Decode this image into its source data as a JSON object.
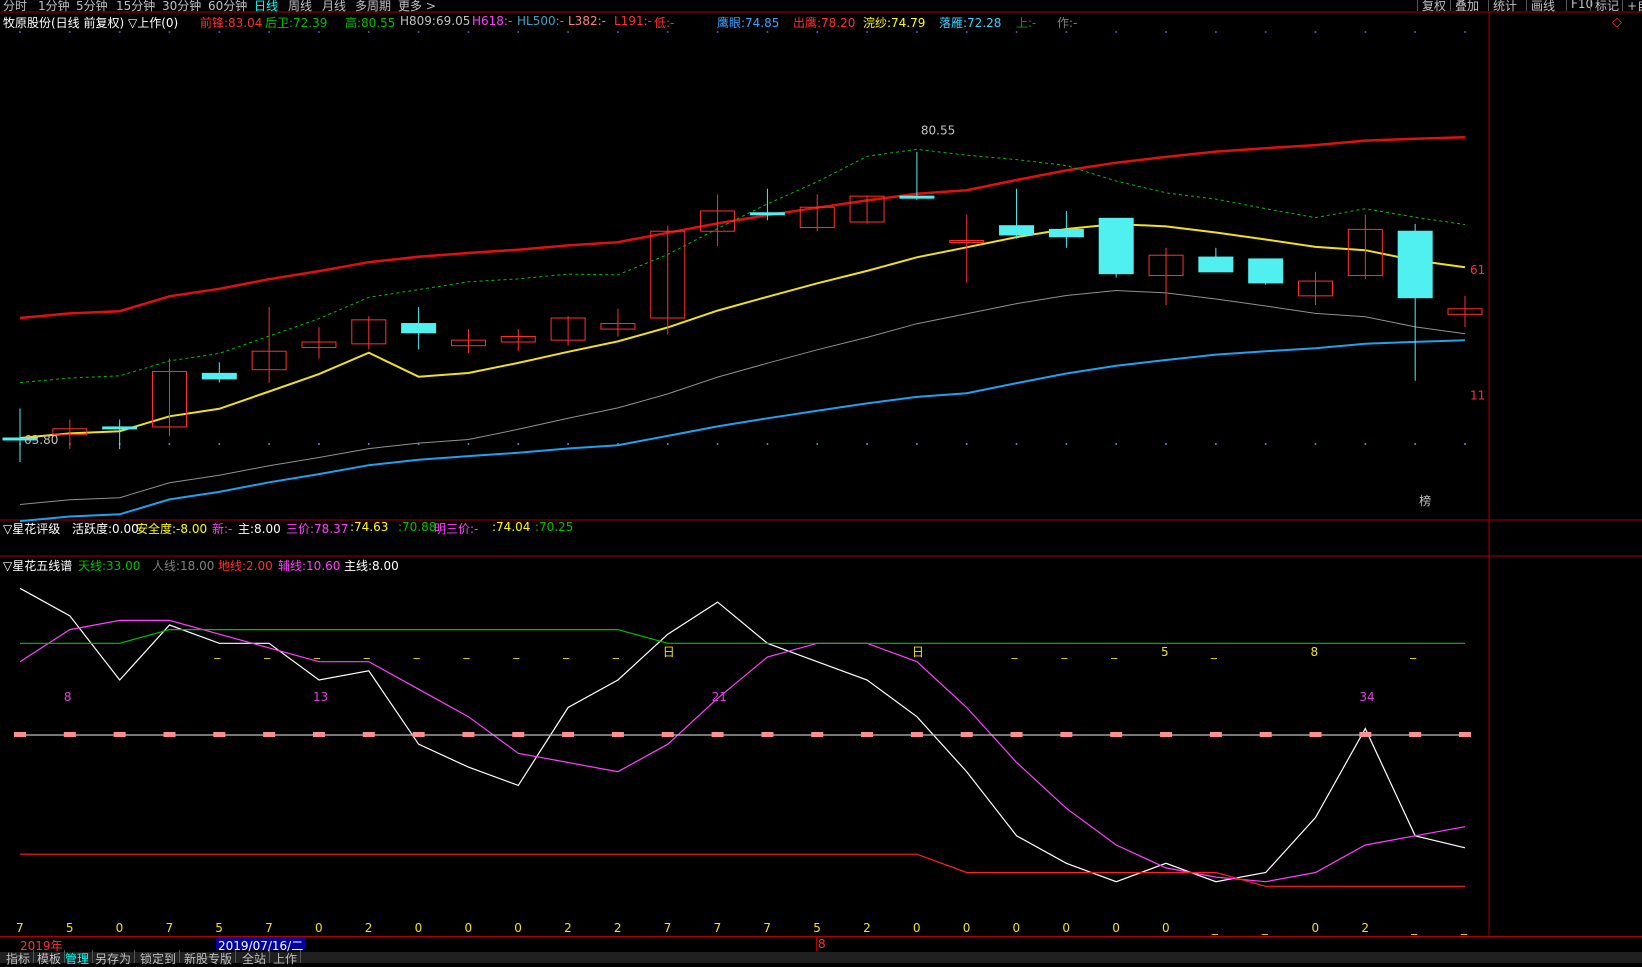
{
  "top_bar": {
    "periods": [
      "分时",
      "1分钟",
      "5分钟",
      "15分钟",
      "30分钟",
      "60分钟",
      "日线",
      "周线",
      "月线",
      "多周期",
      "更多 >"
    ],
    "active_period": "日线",
    "right_buttons": [
      "复权",
      "叠加",
      "统计",
      "画线",
      "F10",
      "标记",
      "+自"
    ]
  },
  "main_header": {
    "title": "牧原股份(日线 前复权) ▽上作(0)",
    "items": [
      {
        "label": "前锋:",
        "value": "83.04",
        "color": "#ff3030"
      },
      {
        "label": "后卫:",
        "value": "72.39",
        "color": "#00c000"
      },
      {
        "label": "高:",
        "value": "80.55",
        "color": "#00c000"
      },
      {
        "label": "H809:",
        "value": "69.05",
        "color": "#c0c0c0"
      },
      {
        "label": "H618:",
        "value": "-",
        "color": "#ff40ff"
      },
      {
        "label": "HL500:",
        "value": "-",
        "color": "#40a0c0"
      },
      {
        "label": "L382:",
        "value": "-",
        "color": "#ff8080"
      },
      {
        "label": "L191:",
        "value": "-",
        "color": "#ff3030"
      },
      {
        "label": "低:",
        "value": "-",
        "color": "#ff3030"
      },
      {
        "label": "鹰眼:",
        "value": "74.85",
        "color": "#40a0ff"
      },
      {
        "label": "出鹰:",
        "value": "78.20",
        "color": "#ff3030"
      },
      {
        "label": "浣纱:",
        "value": "74.79",
        "color": "#ffff00"
      },
      {
        "label": "落雁:",
        "value": "72.28",
        "color": "#40d0ff"
      },
      {
        "label": "上:",
        "value": "-",
        "color": "#00a000"
      },
      {
        "label": "作:",
        "value": "-",
        "color": "#808080"
      }
    ],
    "corner_icon": "diamond-icon"
  },
  "sub1_header": {
    "title": "▽星花评级",
    "items": [
      {
        "label": "活跃度:",
        "value": "0.00",
        "color": "#ffffff"
      },
      {
        "label": "安全度:",
        "value": "-8.00",
        "color": "#ffff00"
      },
      {
        "label": "新:",
        "value": "-",
        "color": "#ff40ff"
      },
      {
        "label": "主:",
        "value": "8.00",
        "color": "#ffffff"
      },
      {
        "label": "三价:",
        "value": "78.37",
        "color": "#ff40ff"
      },
      {
        "label": ":",
        "value": "74.63",
        "color": "#ffff00"
      },
      {
        "label": ":",
        "value": "70.88",
        "color": "#00c000"
      },
      {
        "label": "明三价:",
        "value": "-",
        "color": "#ff40ff"
      },
      {
        "label": ":",
        "value": "74.04",
        "color": "#ffff00"
      },
      {
        "label": ":",
        "value": "70.25",
        "color": "#00c000"
      }
    ]
  },
  "sub2_header": {
    "title": "▽星花五线谱",
    "items": [
      {
        "label": "天线:",
        "value": "33.00",
        "color": "#00c000"
      },
      {
        "label": "人线:",
        "value": "18.00",
        "color": "#808080"
      },
      {
        "label": "地线:",
        "value": "2.00",
        "color": "#ff3030"
      },
      {
        "label": "辅线:",
        "value": "10.60",
        "color": "#ff40ff"
      },
      {
        "label": "主线:",
        "value": "8.00",
        "color": "#ffffff"
      }
    ]
  },
  "chart_data": [
    {
      "type": "candlestick",
      "name": "main",
      "ylim": [
        60,
        86
      ],
      "candles": [
        {
          "o": 63.9,
          "h": 65.5,
          "l": 62.6,
          "c": 63.9,
          "color": "cyan"
        },
        {
          "o": 64.1,
          "h": 64.9,
          "l": 63.3,
          "c": 64.4,
          "color": "red"
        },
        {
          "o": 64.5,
          "h": 64.9,
          "l": 63.3,
          "c": 64.5,
          "color": "cyan"
        },
        {
          "o": 64.5,
          "h": 68.2,
          "l": 64.0,
          "c": 67.5,
          "color": "red"
        },
        {
          "o": 67.4,
          "h": 68.0,
          "l": 66.9,
          "c": 67.1,
          "color": "cyan"
        },
        {
          "o": 67.6,
          "h": 71.0,
          "l": 66.9,
          "c": 68.6,
          "color": "red"
        },
        {
          "o": 68.8,
          "h": 69.9,
          "l": 68.2,
          "c": 69.1,
          "color": "red"
        },
        {
          "o": 69.0,
          "h": 70.5,
          "l": 68.7,
          "c": 70.3,
          "color": "red"
        },
        {
          "o": 70.1,
          "h": 71.0,
          "l": 68.7,
          "c": 69.6,
          "color": "cyan"
        },
        {
          "o": 68.9,
          "h": 69.8,
          "l": 68.5,
          "c": 69.2,
          "color": "red"
        },
        {
          "o": 69.1,
          "h": 69.8,
          "l": 68.6,
          "c": 69.4,
          "color": "red"
        },
        {
          "o": 69.2,
          "h": 70.5,
          "l": 68.9,
          "c": 70.4,
          "color": "red"
        },
        {
          "o": 69.8,
          "h": 70.9,
          "l": 69.4,
          "c": 70.1,
          "color": "red"
        },
        {
          "o": 70.4,
          "h": 75.4,
          "l": 69.5,
          "c": 75.1,
          "color": "red"
        },
        {
          "o": 75.1,
          "h": 77.1,
          "l": 74.3,
          "c": 76.2,
          "color": "red"
        },
        {
          "o": 76.0,
          "h": 77.4,
          "l": 75.7,
          "c": 76.1,
          "color": "cyan"
        },
        {
          "o": 75.3,
          "h": 77.1,
          "l": 75.1,
          "c": 76.4,
          "color": "red"
        },
        {
          "o": 75.6,
          "h": 77.0,
          "l": 75.5,
          "c": 77.0,
          "color": "red"
        },
        {
          "o": 77.0,
          "h": 79.4,
          "l": 76.8,
          "c": 77.0,
          "color": "cyan"
        },
        {
          "o": 74.6,
          "h": 76.0,
          "l": 72.3,
          "c": 74.6,
          "color": "red"
        },
        {
          "o": 75.4,
          "h": 77.4,
          "l": 74.7,
          "c": 74.9,
          "color": "cyan"
        },
        {
          "o": 75.2,
          "h": 76.2,
          "l": 74.2,
          "c": 74.8,
          "color": "cyan"
        },
        {
          "o": 75.8,
          "h": 75.8,
          "l": 72.6,
          "c": 72.8,
          "color": "cyan"
        },
        {
          "o": 72.7,
          "h": 74.2,
          "l": 71.1,
          "c": 73.8,
          "color": "red"
        },
        {
          "o": 73.7,
          "h": 74.2,
          "l": 72.9,
          "c": 72.9,
          "color": "cyan"
        },
        {
          "o": 73.6,
          "h": 73.6,
          "l": 72.2,
          "c": 72.3,
          "color": "cyan"
        },
        {
          "o": 71.6,
          "h": 72.9,
          "l": 71.1,
          "c": 72.4,
          "color": "red"
        },
        {
          "o": 72.7,
          "h": 76.0,
          "l": 72.5,
          "c": 75.2,
          "color": "red"
        },
        {
          "o": 75.1,
          "h": 75.5,
          "l": 67.0,
          "c": 71.5,
          "color": "cyan"
        },
        {
          "o": 70.6,
          "h": 71.6,
          "l": 69.9,
          "c": 70.9,
          "color": "red"
        }
      ],
      "annotations": [
        {
          "text": "80.55",
          "candle": 18,
          "price": 80.55
        },
        {
          "text": "63.80",
          "candle": 0,
          "price": 63.8
        },
        {
          "text": "61",
          "side": "right",
          "price": 73.0
        },
        {
          "text": "11",
          "side": "right",
          "price": 66.2
        },
        {
          "text": "榜",
          "candle": 28,
          "price": 60.5
        }
      ]
    },
    {
      "type": "line",
      "name": "星花五线谱",
      "ylim": [
        0,
        36
      ],
      "series": [
        {
          "name": "主线",
          "color": "#ffffff",
          "values": [
            34,
            31,
            24,
            30,
            28,
            28,
            24,
            25,
            17,
            14.5,
            12.5,
            21,
            24,
            29,
            32.5,
            28,
            26,
            24,
            20,
            14,
            7,
            4,
            2,
            4,
            2,
            3,
            9,
            18.7,
            7,
            5.7
          ]
        },
        {
          "name": "辅线",
          "color": "#ff40ff",
          "values": [
            26,
            29.5,
            30.5,
            30.5,
            29,
            27.5,
            26,
            26,
            23,
            20,
            16,
            15,
            14,
            17,
            22,
            26.5,
            28,
            28,
            26,
            21,
            15,
            10,
            6,
            3.5,
            2.5,
            2,
            3,
            6,
            7,
            8
          ]
        },
        {
          "name": "天线",
          "color": "#00c000",
          "values": [
            28,
            28,
            28,
            29.5,
            29.5,
            29.5,
            29.5,
            29.5,
            29.5,
            29.5,
            29.5,
            29.5,
            29.5,
            28,
            28,
            28,
            28,
            28,
            28,
            28,
            28,
            28,
            28,
            28,
            28,
            28,
            28,
            28,
            28,
            28
          ]
        },
        {
          "name": "人线",
          "color": "#c0c0c0",
          "values": [
            18,
            18,
            18,
            18,
            18,
            18,
            18,
            18,
            18,
            18,
            18,
            18,
            18,
            18,
            18,
            18,
            18,
            18,
            18,
            18,
            18,
            18,
            18,
            18,
            18,
            18,
            18,
            18,
            18,
            18
          ]
        },
        {
          "name": "地线",
          "color": "#ff2020",
          "values": [
            5,
            5,
            5,
            5,
            5,
            5,
            5,
            5,
            5,
            5,
            5,
            5,
            5,
            5,
            5,
            5,
            5,
            5,
            5,
            3,
            3,
            3,
            3,
            3,
            3,
            1.5,
            1.5,
            1.5,
            1.5,
            1.5
          ]
        }
      ],
      "top_labels": [
        "",
        "",
        "",
        "",
        "_",
        "_",
        "_",
        "_",
        "_",
        "_",
        "_",
        "_",
        "_",
        "日",
        "",
        "",
        "",
        "",
        "日",
        "",
        "_",
        "_",
        "_",
        "5",
        "_",
        "",
        "8",
        "",
        "_",
        ""
      ],
      "mid_labels": [
        {
          "i": 1,
          "text": "8"
        },
        {
          "i": 6,
          "text": "13"
        },
        {
          "i": 14,
          "text": "21"
        },
        {
          "i": 27,
          "text": "34"
        }
      ],
      "bottom_labels": [
        "7",
        "5",
        "0",
        "7",
        "5",
        "7",
        "0",
        "2",
        "0",
        "0",
        "0",
        "2",
        "2",
        "7",
        "7",
        "7",
        "5",
        "2",
        "0",
        "0",
        "0",
        "0",
        "0",
        "0",
        "_",
        "_",
        "0",
        "2",
        "_",
        "_"
      ]
    }
  ],
  "date_bar": {
    "year": "2019年",
    "selected_date": "2019/07/16/二",
    "marker": "8"
  },
  "tabs": [
    "指标",
    "模板",
    "管理",
    "另存为",
    "锁定到",
    "新股专版",
    "全站",
    "上作"
  ],
  "active_tab": "管理"
}
